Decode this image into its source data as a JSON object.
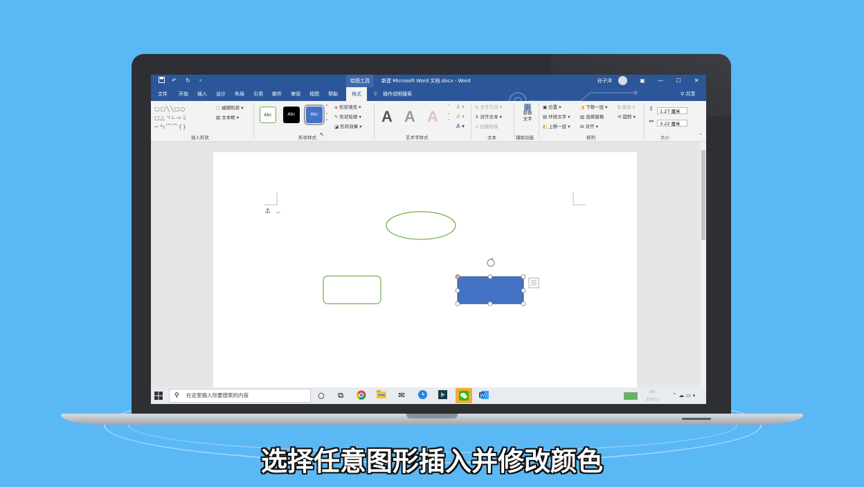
{
  "word": {
    "titlebar": {
      "quick_access": [
        "save-icon",
        "undo-icon",
        "redo-icon",
        "customize-icon"
      ],
      "contextual_tab": "绘图工具",
      "document_title": "新建 Microsoft Word 文档.docx - Word",
      "user_name": "孙子洋"
    },
    "tabs": [
      "文件",
      "开始",
      "插入",
      "设计",
      "布局",
      "引用",
      "邮件",
      "审阅",
      "视图",
      "帮助",
      "格式"
    ],
    "active_tab": "格式",
    "tell_me": "操作说明搜索",
    "share": "共享",
    "ribbon": {
      "insert_shapes": {
        "label": "插入形状",
        "edit_shape": "编辑形状",
        "text_box": "文本框"
      },
      "shape_styles": {
        "label": "形状样式",
        "swatches": [
          "Abc",
          "Abc",
          "Abc"
        ],
        "fill": "形状填充",
        "outline": "形状轮廓",
        "effects": "形状效果"
      },
      "wordart_styles": {
        "label": "艺术字样式",
        "samples": [
          "A",
          "A",
          "A"
        ]
      },
      "text": {
        "label": "文本",
        "direction": "文字方向",
        "align": "对齐文本",
        "link": "创建链接"
      },
      "accessibility": {
        "label": "辅助功能",
        "alt_text": "替换\n文字"
      },
      "arrange": {
        "label": "排列",
        "position": "位置",
        "wrap_text": "环绕文字",
        "bring_forward": "上移一层",
        "send_backward": "下移一层",
        "selection_pane": "选择窗格",
        "align": "对齐",
        "group": "组合",
        "rotate": "旋转"
      },
      "size": {
        "label": "大小",
        "height": "1.27 厘米",
        "width": "3.22 厘米"
      }
    },
    "shapes": {
      "ellipse_color": "#70ad47",
      "rounded_rect_color": "#70ad47",
      "selected_fill": "#4472c4"
    }
  },
  "taskbar": {
    "search_placeholder": "在这里输入你要搜索的内容",
    "icons": [
      "cortana-icon",
      "task-view-icon",
      "chrome-icon",
      "file-explorer-icon",
      "mail-icon",
      "clock-app-icon",
      "media-app-icon",
      "wechat-icon",
      "word-icon"
    ],
    "tray_time": "18:",
    "tray_date": "2021/"
  },
  "caption": "选择任意图形插入并修改颜色"
}
